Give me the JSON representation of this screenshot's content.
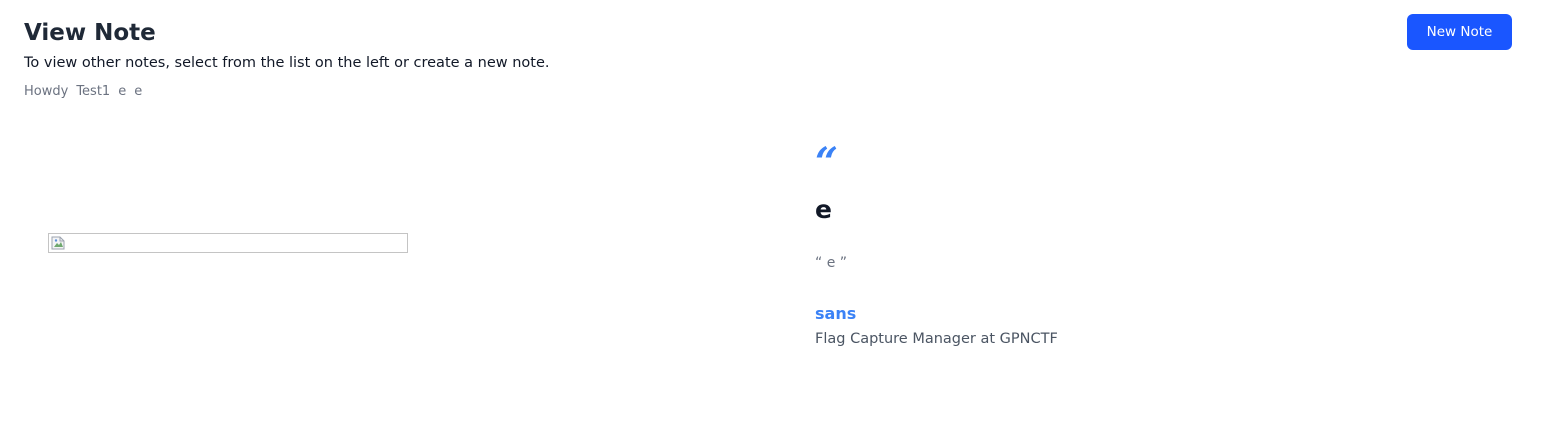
{
  "header": {
    "title": "View Note",
    "subtitle": "To view other notes, select from the list on the left or create a new note.",
    "new_note_label": "New Note"
  },
  "breadcrumb": {
    "items": [
      "Howdy",
      "Test1",
      "e",
      "e"
    ]
  },
  "note": {
    "image_icon": "broken-image-icon",
    "quote_mark": "“",
    "title": "e",
    "quote": "“ e ”",
    "author": "sans",
    "author_role": "Flag Capture Manager at GPNCTF"
  },
  "colors": {
    "accent": "#1a56ff",
    "link": "#3b82f6"
  }
}
